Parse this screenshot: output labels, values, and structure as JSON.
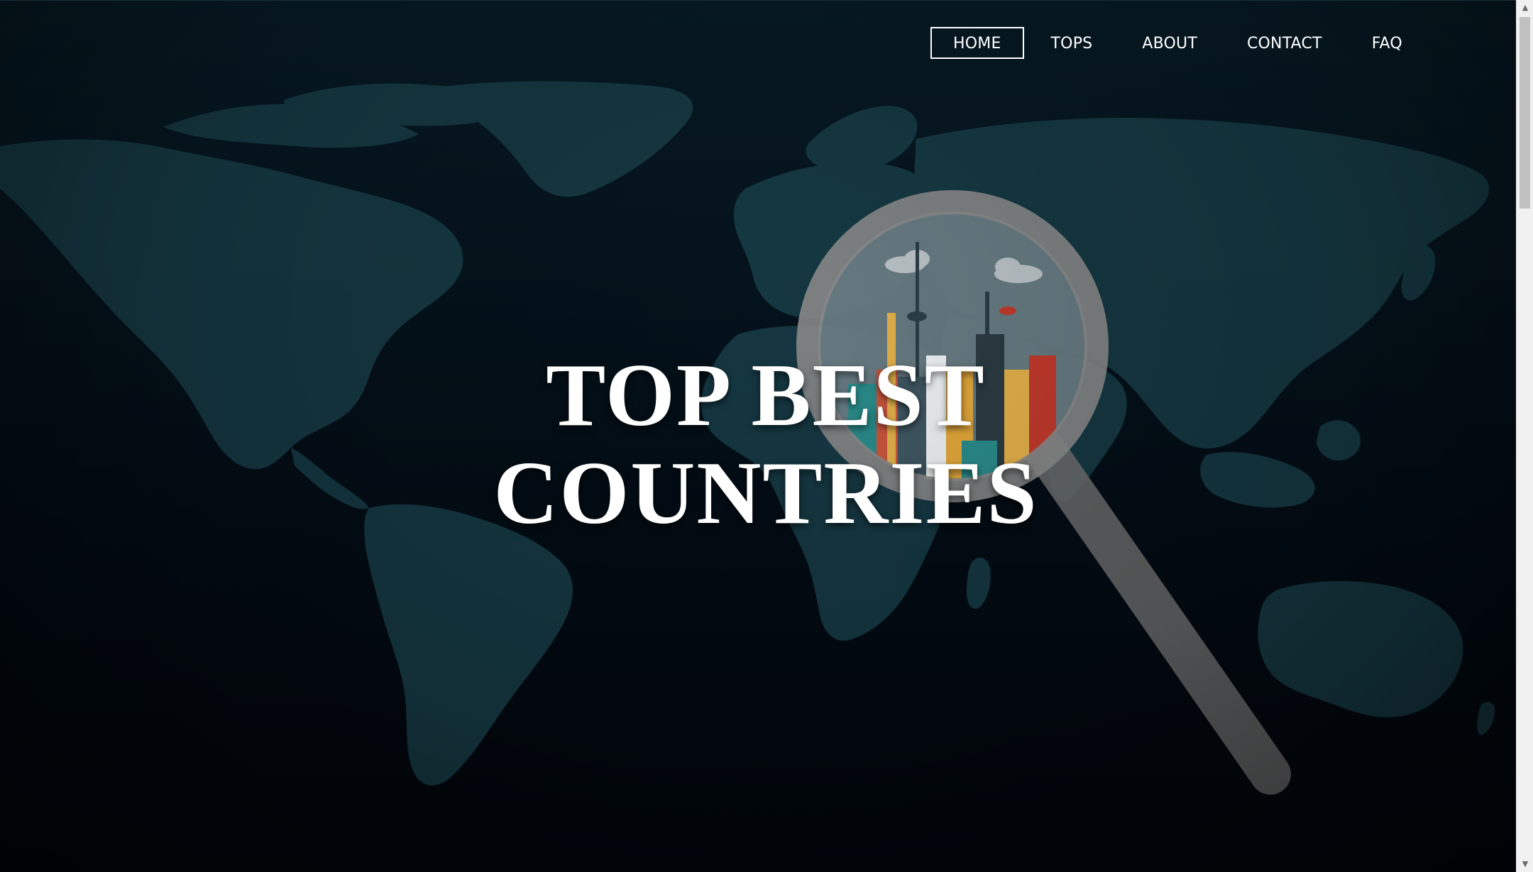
{
  "nav": {
    "items": [
      {
        "label": "HOME",
        "active": true
      },
      {
        "label": "TOPS",
        "active": false
      },
      {
        "label": "ABOUT",
        "active": false
      },
      {
        "label": "CONTACT",
        "active": false
      },
      {
        "label": "FAQ",
        "active": false
      }
    ]
  },
  "hero": {
    "title_line1": "TOP BEST",
    "title_line2": "COUNTRIES"
  },
  "colors": {
    "background_top": "#071a24",
    "background_bottom": "#01060c",
    "continents": "#163a44",
    "magnifier_ring": "#8a8a8a",
    "text": "#ffffff"
  },
  "icons": {
    "scroll_up": "▲",
    "scroll_down": "▼"
  }
}
